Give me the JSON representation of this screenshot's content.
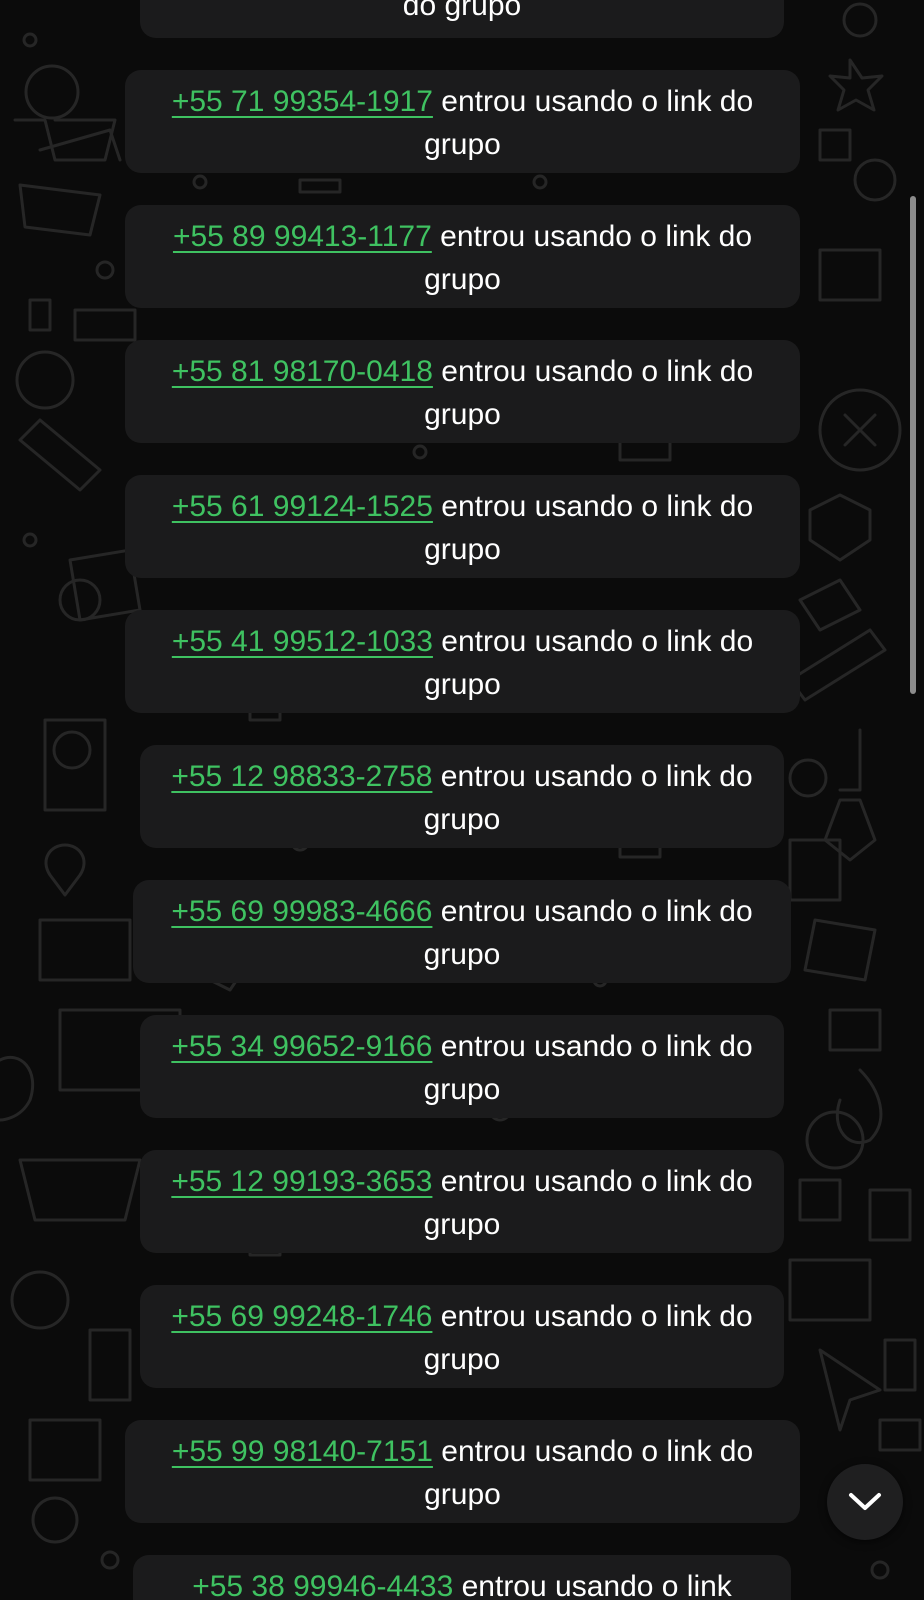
{
  "messages": [
    {
      "phone": "",
      "text": "do grupo"
    },
    {
      "phone": "+55 71 99354-1917",
      "text": " entrou usando o link do grupo"
    },
    {
      "phone": "+55 89 99413-1177",
      "text": " entrou usando o link do grupo"
    },
    {
      "phone": "+55 81 98170-0418",
      "text": " entrou usando o link do grupo"
    },
    {
      "phone": "+55 61 99124-1525",
      "text": " entrou usando o link do grupo"
    },
    {
      "phone": "+55 41 99512-1033",
      "text": " entrou usando o link do grupo"
    },
    {
      "phone": "+55 12 98833-2758",
      "text": " entrou usando o link do grupo"
    },
    {
      "phone": "+55 69 99983-4666",
      "text": " entrou usando o link do grupo"
    },
    {
      "phone": "+55 34 99652-9166",
      "text": " entrou usando o link do grupo"
    },
    {
      "phone": "+55 12 99193-3653",
      "text": " entrou usando o link do grupo"
    },
    {
      "phone": "+55 69 99248-1746",
      "text": " entrou usando o link do grupo"
    },
    {
      "phone": "+55 99 98140-7151",
      "text": " entrou usando o link do grupo"
    },
    {
      "phone": "+55 38 99946-4433",
      "text": " entrou usando o link"
    }
  ],
  "scroll_down_button": {
    "icon": "chevron-down-icon"
  },
  "colors": {
    "background": "#0b0b0b",
    "bubble": "#1b1b1c",
    "link": "#3fc261",
    "text": "#ffffff"
  }
}
